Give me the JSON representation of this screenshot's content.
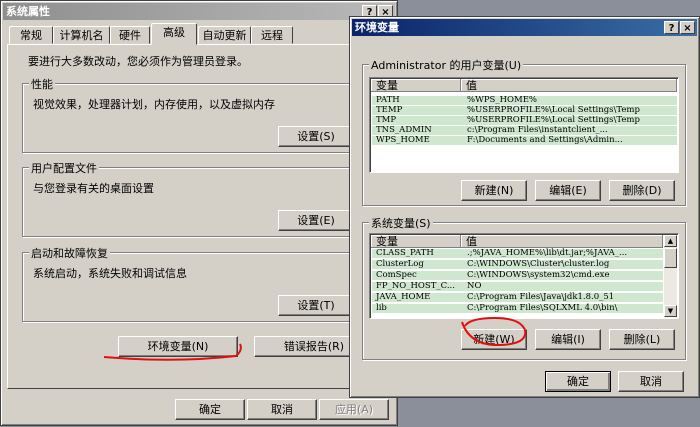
{
  "sysprops": {
    "title": "系统属性",
    "tabs": [
      "常规",
      "计算机名",
      "硬件",
      "高级",
      "自动更新",
      "远程"
    ],
    "admin_note": "要进行大多数改动，您必须作为管理员登录。",
    "performance": {
      "label": "性能",
      "desc": "视觉效果，处理器计划，内存使用，以及虚拟内存",
      "button": "设置(S)"
    },
    "profiles": {
      "label": "用户配置文件",
      "desc": "与您登录有关的桌面设置",
      "button": "设置(E)"
    },
    "startup": {
      "label": "启动和故障恢复",
      "desc": "系统启动，系统失败和调试信息",
      "button": "设置(T)"
    },
    "env_button": "环境变量(N)",
    "error_button": "错误报告(R)",
    "ok": "确定",
    "cancel": "取消",
    "apply": "应用(A)"
  },
  "envvars": {
    "title": "环境变量",
    "user_group": "Administrator 的用户变量(U)",
    "col_var": "变量",
    "col_val": "值",
    "user_vars": [
      {
        "name": "PATH",
        "value": "%WPS_HOME%"
      },
      {
        "name": "TEMP",
        "value": "%USERPROFILE%\\Local Settings\\Temp"
      },
      {
        "name": "TMP",
        "value": "%USERPROFILE%\\Local Settings\\Temp"
      },
      {
        "name": "TNS_ADMIN",
        "value": "c:\\Program Files\\instantclient_..."
      },
      {
        "name": "WPS_HOME",
        "value": "F:\\Documents and Settings\\Admin..."
      }
    ],
    "user_new": "新建(N)",
    "user_edit": "编辑(E)",
    "user_delete": "删除(D)",
    "sys_group": "系统变量(S)",
    "sys_vars": [
      {
        "name": "CLASS_PATH",
        "value": ".;%JAVA_HOME%\\lib\\dt.jar;%JAVA_..."
      },
      {
        "name": "ClusterLog",
        "value": "C:\\WINDOWS\\Cluster\\cluster.log"
      },
      {
        "name": "ComSpec",
        "value": "C:\\WINDOWS\\system32\\cmd.exe"
      },
      {
        "name": "FP_NO_HOST_C...",
        "value": "NO"
      },
      {
        "name": "JAVA_HOME",
        "value": "C:\\Program Files\\Java\\jdk1.8.0_51"
      },
      {
        "name": "lib",
        "value": "C:\\Program Files\\SQLXML 4.0\\bin\\"
      }
    ],
    "sys_new": "新建(W)",
    "sys_edit": "编辑(I)",
    "sys_delete": "删除(L)",
    "ok": "确定",
    "cancel": "取消"
  },
  "titlebar_buttons": {
    "help": "?",
    "close": "×"
  }
}
